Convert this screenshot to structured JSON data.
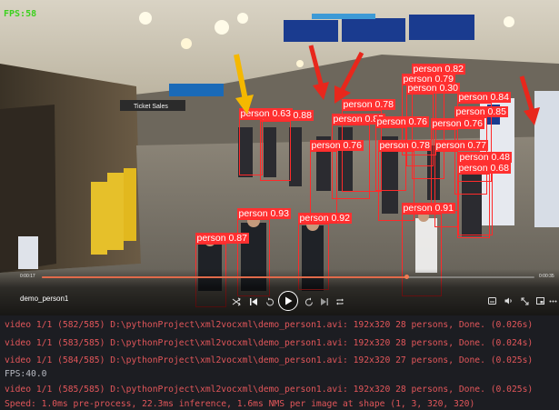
{
  "video": {
    "overlay_fps": "FPS:58",
    "title": "demo_person1",
    "time_current": "0:00:17",
    "time_total": "0:00:35",
    "progress": 0.74,
    "sign_text": "Ticket Sales",
    "detections": [
      {
        "label": "person 0.82"
      },
      {
        "label": "person 0.79"
      },
      {
        "label": "person 0.30"
      },
      {
        "label": "person 0.84"
      },
      {
        "label": "person 0.85"
      },
      {
        "label": "person 0.78"
      },
      {
        "label": "person 0.88"
      },
      {
        "label": "person 0.85"
      },
      {
        "label": "person 0.76"
      },
      {
        "label": "person 0.77"
      },
      {
        "label": "person 0.48"
      },
      {
        "label": "person 0.68"
      },
      {
        "label": "person 0.93"
      },
      {
        "label": "person 0.92"
      },
      {
        "label": "person 0.87"
      },
      {
        "label": "person 0.91"
      },
      {
        "label": "person 0.76"
      },
      {
        "label": "person 0.78"
      },
      {
        "label": "person 0.63"
      },
      {
        "label": "person 0.76"
      }
    ],
    "controls": [
      {
        "name": "shuffle-icon"
      },
      {
        "name": "previous-icon"
      },
      {
        "name": "rewind-10-icon"
      },
      {
        "name": "play-icon"
      },
      {
        "name": "forward-30-icon"
      },
      {
        "name": "next-icon"
      },
      {
        "name": "repeat-icon"
      },
      {
        "name": "subtitles-icon"
      },
      {
        "name": "volume-icon"
      },
      {
        "name": "fullscreen-icon"
      },
      {
        "name": "miniplayer-icon"
      },
      {
        "name": "more-icon"
      }
    ],
    "colors": {
      "box": "#ff2a2a",
      "arrow_yellow": "#f5b800",
      "arrow_red": "#e8271c",
      "fps": "#3cd11e",
      "seek": "#e06a4a"
    }
  },
  "terminal": {
    "lines": [
      {
        "text": "video 1/1 (582/585) D:\\pythonProject\\xml2vocxml\\demo_person1.avi: 192x320 28 persons, Done. (0.026s)",
        "kind": "err"
      },
      {
        "text": "video 1/1 (583/585) D:\\pythonProject\\xml2vocxml\\demo_person1.avi: 192x320 28 persons, Done. (0.024s)",
        "kind": "err"
      },
      {
        "text": "video 1/1 (584/585) D:\\pythonProject\\xml2vocxml\\demo_person1.avi: 192x320 27 persons, Done. (0.025s)",
        "kind": "err"
      },
      {
        "text": "FPS:40.0",
        "kind": "std"
      },
      {
        "text": "video 1/1 (585/585) D:\\pythonProject\\xml2vocxml\\demo_person1.avi: 192x320 28 persons, Done. (0.025s)",
        "kind": "err"
      },
      {
        "text": "Speed: 1.0ms pre-process, 22.3ms inference, 1.6ms NMS per image at shape (1, 3, 320, 320)",
        "kind": "err"
      }
    ]
  }
}
